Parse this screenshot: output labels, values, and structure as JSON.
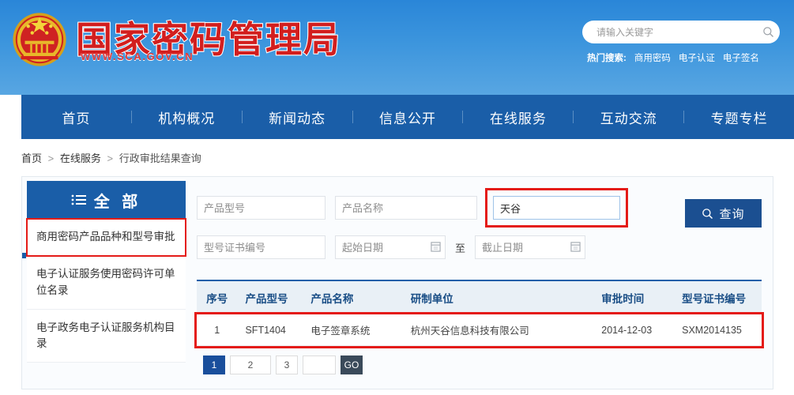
{
  "header": {
    "site_title": "国家密码管理局",
    "site_url": "WWW.SCA.GOV.CN",
    "emblem_alt": "national-emblem",
    "search": {
      "placeholder": "请输入关键字",
      "value": "",
      "icon": "search-icon"
    },
    "hot": {
      "label": "热门搜索:",
      "links": [
        "商用密码",
        "电子认证",
        "电子签名"
      ]
    },
    "colors": {
      "bg_top": "#2a86d8",
      "bg_bottom": "#58a6e2",
      "title": "#d21e1e"
    }
  },
  "nav": {
    "items": [
      "首页",
      "机构概况",
      "新闻动态",
      "信息公开",
      "在线服务",
      "互动交流",
      "专题专栏"
    ],
    "bg": "#1a5ea8"
  },
  "breadcrumb": {
    "items": [
      "首页",
      "在线服务",
      "行政审批结果查询"
    ],
    "separator": ">"
  },
  "sidebar": {
    "head_label": "全 部",
    "head_icon": "list-icon",
    "items": [
      {
        "label": "商用密码产品品种和型号审批",
        "selected": true
      },
      {
        "label": "电子认证服务使用密码许可单位名录",
        "selected": false
      },
      {
        "label": "电子政务电子认证服务机构目录",
        "selected": false
      }
    ]
  },
  "search_form": {
    "product_model": {
      "placeholder": "产品型号",
      "value": ""
    },
    "product_name": {
      "placeholder": "产品名称",
      "value": ""
    },
    "keyword": {
      "placeholder": "",
      "value": "天谷",
      "focused": true,
      "highlight": "#e41b17"
    },
    "cert_no": {
      "placeholder": "型号证书编号",
      "value": ""
    },
    "date_start": {
      "placeholder": "起始日期",
      "value": "",
      "icon": "calendar-icon"
    },
    "date_to_label": "至",
    "date_end": {
      "placeholder": "截止日期",
      "value": "",
      "icon": "calendar-icon"
    },
    "query_button": {
      "label": "查询",
      "icon": "search-icon",
      "bg": "#1b4f91"
    }
  },
  "table": {
    "columns": [
      "序号",
      "产品型号",
      "产品名称",
      "研制单位",
      "审批时间",
      "型号证书编号"
    ],
    "rows": [
      {
        "index": "1",
        "model": "SFT1404",
        "name": "电子签章系统",
        "unit": "杭州天谷信息科技有限公司",
        "date": "2014-12-03",
        "cert": "SXM2014135",
        "highlight": true
      }
    ]
  },
  "pagination": {
    "pages": [
      "1",
      "2",
      "3"
    ],
    "active": "1",
    "jump_value": "",
    "go_label": "GO"
  }
}
